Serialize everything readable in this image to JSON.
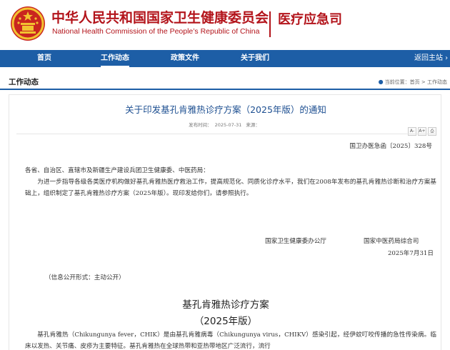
{
  "header": {
    "org_cn": "中华人民共和国国家卫生健康委员会",
    "org_en": "National Health Commission of the People’s Republic of China",
    "dept": "医疗应急司",
    "colors": {
      "brand_red": "#b3141b",
      "nav_blue": "#1d5ea6",
      "emblem_gold": "#f2c230"
    }
  },
  "nav": {
    "items": [
      "首页",
      "工作动态",
      "政策文件",
      "关于我们"
    ],
    "active": "工作动态",
    "back_home": "返回主站 ›"
  },
  "crumbbar": {
    "section_title": "工作动态",
    "location_label": "当前位置：",
    "home": "首页",
    "sep": " > ",
    "current": "工作动态"
  },
  "article": {
    "title": "关于印发基孔肯雅热诊疗方案（2025年版）的通知",
    "meta_date_label": "发布时间：",
    "meta_date": "2025-07-31",
    "meta_source_label": "来源：",
    "tools": [
      "A-",
      "A+",
      "print-icon"
    ],
    "doc_no": "国卫办医急函〔2025〕328号",
    "addressee": "各省、自治区、直辖市及新疆生产建设兵团卫生健康委、中医药局：",
    "paragraph": "为进一步指导各级各类医疗机构做好基孔肯雅热医疗救治工作，提高规范化、同质化诊疗水平，我们在2008年发布的基孔肯雅热诊断和治疗方案基础上，组织制定了基孔肯雅热诊疗方案（2025年版）。现印发给你们，请参照执行。",
    "signer1": "国家卫生健康委办公厅",
    "signer2": "国家中医药局综合司",
    "date": "2025年7月31日",
    "disclosure": "（信息公开形式：主动公开）",
    "sub_title": "基孔肯雅热诊疗方案",
    "sub_year": "（2025年版）",
    "intro": "基孔肯雅热（Chikungunya fever，CHIK）是由基孔肯雅病毒（Chikungunya virus，CHIKV）感染引起，经伊蚊叮咬传播的急性传染病。临床以发热、关节痛、皮疹为主要特征。基孔肯雅热在全球热带和亚热带地区广泛流行，流行"
  }
}
